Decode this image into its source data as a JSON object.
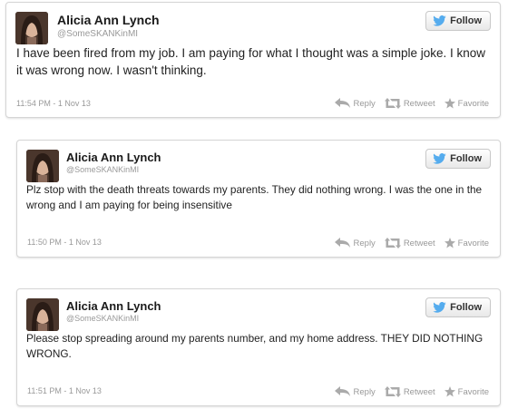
{
  "brand_color": "#55acee",
  "tweets": [
    {
      "name": "Alicia Ann Lynch",
      "handle": "@SomeSKANKinMI",
      "follow_label": "Follow",
      "text": "I have been fired from my job. I am paying for what I thought was a simple joke. I know it was wrong now. I wasn't thinking.",
      "timestamp": "11:54 PM - 1 Nov 13",
      "reply_label": "Reply",
      "retweet_label": "Retweet",
      "favorite_label": "Favorite"
    },
    {
      "name": "Alicia Ann Lynch",
      "handle": "@SomeSKANKinMI",
      "follow_label": "Follow",
      "text": "Plz stop with the death threats towards my parents. They did nothing wrong. I was the one in the wrong and I am paying for being insensitive",
      "timestamp": "11:50 PM - 1 Nov 13",
      "reply_label": "Reply",
      "retweet_label": "Retweet",
      "favorite_label": "Favorite"
    },
    {
      "name": "Alicia Ann Lynch",
      "handle": "@SomeSKANKinMI",
      "follow_label": "Follow",
      "text": "Please stop spreading around my parents number, and my home address. THEY DID NOTHING WRONG.",
      "timestamp": "11:51 PM - 1 Nov 13",
      "reply_label": "Reply",
      "retweet_label": "Retweet",
      "favorite_label": "Favorite"
    }
  ]
}
